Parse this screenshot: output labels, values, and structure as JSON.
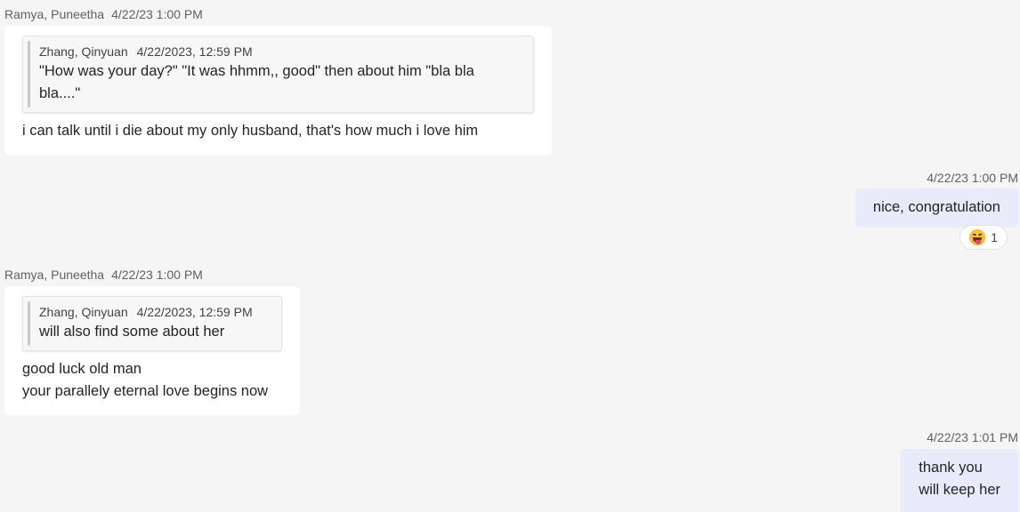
{
  "messages": [
    {
      "sender": "Ramya, Puneetha",
      "timestamp": "4/22/23 1:00 PM",
      "quote": {
        "author": "Zhang, Qinyuan",
        "timestamp": "4/22/2023, 12:59 PM",
        "lines": [
          "\"How was your day?\" \"It was hhmm,, good\" then about him \"bla bla",
          "bla....\""
        ]
      },
      "lines": [
        "i can talk until i die about my only husband, that's how much i love him"
      ]
    },
    {
      "timestamp": "4/22/23 1:00 PM",
      "lines": [
        "nice, congratulation"
      ],
      "reaction": {
        "icon": "squinting-tongue-emoji-icon",
        "count": "1"
      }
    },
    {
      "sender": "Ramya, Puneetha",
      "timestamp": "4/22/23 1:00 PM",
      "quote": {
        "author": "Zhang, Qinyuan",
        "timestamp": "4/22/2023, 12:59 PM",
        "lines": [
          "will also find some about her"
        ]
      },
      "lines": [
        "good luck old man",
        "your parallely eternal love begins now"
      ]
    },
    {
      "timestamp": "4/22/23 1:01 PM",
      "lines": [
        "thank you",
        "will keep her"
      ]
    }
  ],
  "colors": {
    "background": "#f5f5f5",
    "incoming_bubble": "#ffffff",
    "outgoing_bubble": "#e8ebfa",
    "meta_text": "#616161"
  }
}
